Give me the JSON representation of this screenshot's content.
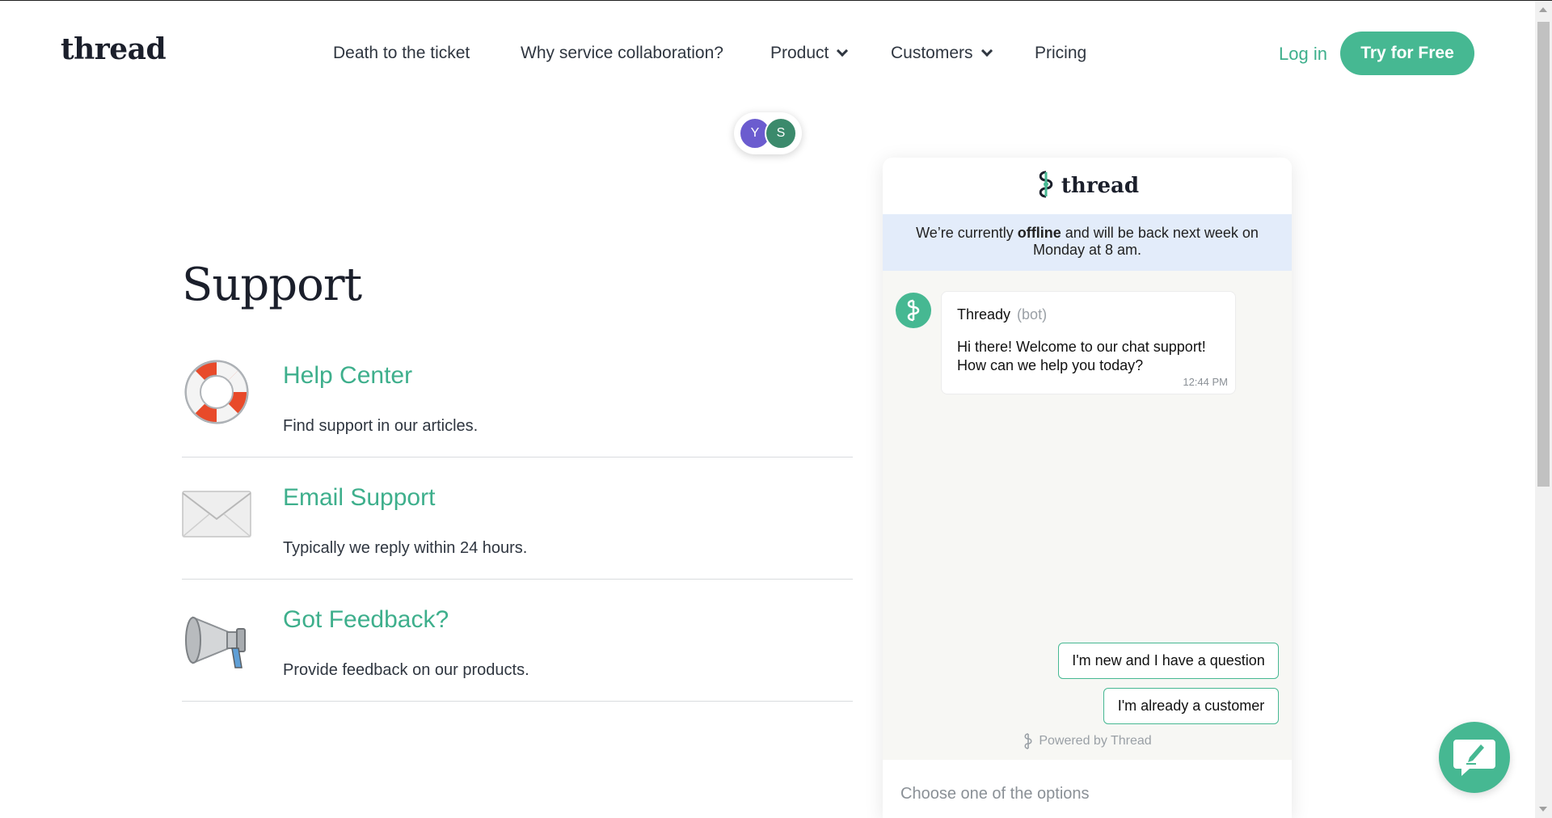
{
  "header": {
    "logo": "thread",
    "nav": [
      {
        "label": "Death to the ticket",
        "has_dropdown": false
      },
      {
        "label": "Why service collaboration?",
        "has_dropdown": false
      },
      {
        "label": "Product",
        "has_dropdown": true
      },
      {
        "label": "Customers",
        "has_dropdown": true
      },
      {
        "label": "Pricing",
        "has_dropdown": false
      }
    ],
    "login_label": "Log in",
    "cta_label": "Try for Free"
  },
  "avatars": [
    "Y",
    "S"
  ],
  "support": {
    "title": "Support",
    "items": [
      {
        "title": "Help Center",
        "description": "Find support in our articles.",
        "icon": "lifebuoy-icon"
      },
      {
        "title": "Email Support",
        "description": "Typically we reply within 24 hours.",
        "icon": "envelope-icon"
      },
      {
        "title": "Got Feedback?",
        "description": "Provide feedback on our products.",
        "icon": "megaphone-icon"
      }
    ]
  },
  "chat": {
    "brand": "thread",
    "offline_prefix": "We’re currently ",
    "offline_bold": "offline",
    "offline_suffix": " and will be back next week on Monday at 8 am.",
    "bot_name": "Thready",
    "bot_tag": "(bot)",
    "message_line1": "Hi there! Welcome to our chat support!",
    "message_line2": "How can we help you today?",
    "message_time": "12:44 PM",
    "options": [
      "I'm new and I have a question",
      "I'm already a customer"
    ],
    "powered_by": "Powered by Thread",
    "input_placeholder": "Choose one of the options"
  },
  "colors": {
    "accent": "#46b892",
    "link": "#3eaf8c",
    "offline_banner": "#e3ecfa",
    "avatar_y": "#6b5ccf",
    "avatar_s": "#3b8a6c"
  }
}
